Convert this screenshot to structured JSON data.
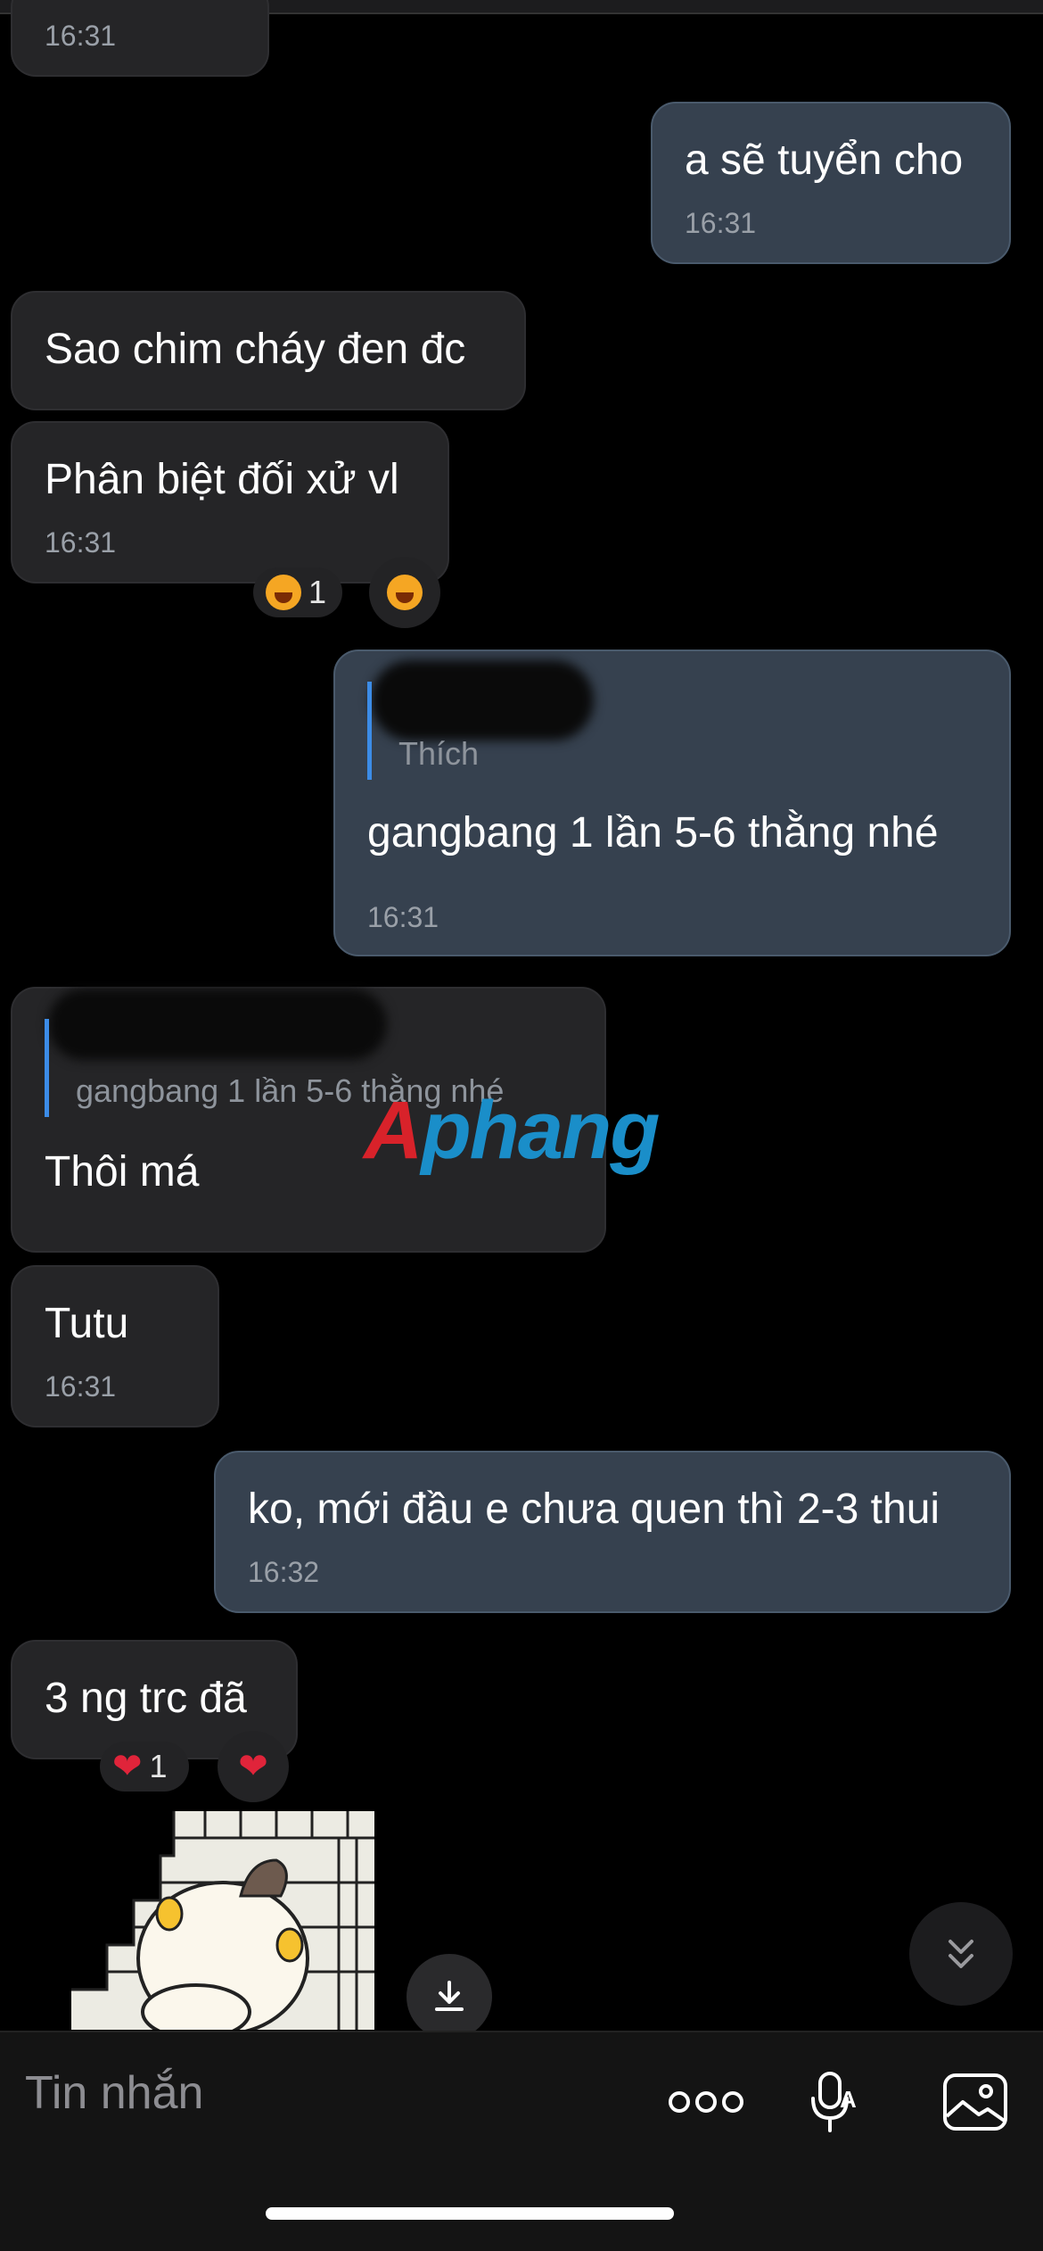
{
  "messages": [
    {
      "id": "m0",
      "time": "16:31"
    },
    {
      "id": "m1",
      "text": "a sẽ tuyển cho",
      "time": "16:31"
    },
    {
      "id": "m2",
      "text": "Sao chim cháy đen đc"
    },
    {
      "id": "m3",
      "text": "Phân biệt đối xử vl",
      "time": "16:31",
      "reaction": {
        "emoji": "laugh-emoji",
        "count": "1"
      }
    },
    {
      "id": "m4",
      "quote": "Thích",
      "text": "gangbang 1 lần 5-6 thằng nhé",
      "time": "16:31"
    },
    {
      "id": "m5",
      "quote": "gangbang 1 lần 5-6 thằng nhé",
      "text": "Thôi má"
    },
    {
      "id": "m6",
      "text": "Tutu",
      "time": "16:31"
    },
    {
      "id": "m7",
      "text": "ko, mới đầu e chưa quen thì 2-3 thui",
      "time": "16:32"
    },
    {
      "id": "m8",
      "text": "3 ng trc đã",
      "reaction": {
        "emoji": "heart-emoji",
        "count": "1"
      }
    }
  ],
  "watermark": {
    "part1": "A",
    "part2": "phang"
  },
  "composer": {
    "placeholder": "Tin nhắn"
  },
  "icons": {
    "download": "download-icon",
    "scroll_down": "double-chevron-down-icon",
    "more": "more-dots-icon",
    "voice": "voice-to-text-icon",
    "image": "image-icon"
  },
  "colors": {
    "incoming_bubble": "#252527",
    "outgoing_bubble": "#36414f",
    "quote_bar": "#3c8ce7",
    "background": "#000000"
  }
}
